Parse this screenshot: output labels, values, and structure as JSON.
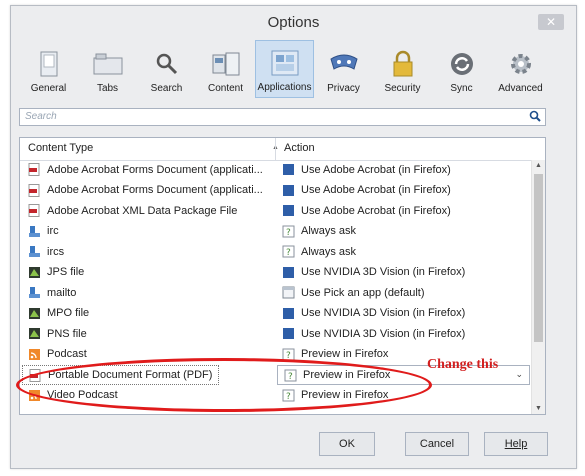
{
  "window": {
    "title": "Options",
    "close_label": "✕"
  },
  "toolbar": {
    "items": [
      {
        "label": "General",
        "icon": "general-icon"
      },
      {
        "label": "Tabs",
        "icon": "tabs-icon"
      },
      {
        "label": "Search",
        "icon": "search-icon"
      },
      {
        "label": "Content",
        "icon": "content-icon"
      },
      {
        "label": "Applications",
        "icon": "applications-icon",
        "selected": true
      },
      {
        "label": "Privacy",
        "icon": "privacy-icon"
      },
      {
        "label": "Security",
        "icon": "security-icon"
      },
      {
        "label": "Sync",
        "icon": "sync-icon"
      },
      {
        "label": "Advanced",
        "icon": "advanced-icon"
      }
    ]
  },
  "search": {
    "placeholder": "Search"
  },
  "table": {
    "headers": {
      "content_type": "Content Type",
      "action": "Action"
    },
    "rows": [
      {
        "type": "Adobe Acrobat Forms Document (applicati...",
        "action": "Use Adobe Acrobat (in Firefox)",
        "type_icon": "pdf-icon",
        "action_icon": "blue-app-icon"
      },
      {
        "type": "Adobe Acrobat Forms Document (applicati...",
        "action": "Use Adobe Acrobat (in Firefox)",
        "type_icon": "pdf-icon",
        "action_icon": "blue-app-icon"
      },
      {
        "type": "Adobe Acrobat XML Data Package File",
        "action": "Use Adobe Acrobat (in Firefox)",
        "type_icon": "pdf-icon",
        "action_icon": "blue-app-icon"
      },
      {
        "type": "irc",
        "action": "Always ask",
        "type_icon": "chat-icon",
        "action_icon": "ask-icon"
      },
      {
        "type": "ircs",
        "action": "Always ask",
        "type_icon": "chat-icon",
        "action_icon": "ask-icon"
      },
      {
        "type": "JPS file",
        "action": "Use NVIDIA 3D Vision (in Firefox)",
        "type_icon": "nvidia-icon",
        "action_icon": "blue-app-icon"
      },
      {
        "type": "mailto",
        "action": "Use Pick an app (default)",
        "type_icon": "chat-icon",
        "action_icon": "window-icon"
      },
      {
        "type": "MPO file",
        "action": "Use NVIDIA 3D Vision (in Firefox)",
        "type_icon": "nvidia-icon",
        "action_icon": "blue-app-icon"
      },
      {
        "type": "PNS file",
        "action": "Use NVIDIA 3D Vision (in Firefox)",
        "type_icon": "nvidia-icon",
        "action_icon": "blue-app-icon"
      },
      {
        "type": "Podcast",
        "action": "Preview in Firefox",
        "type_icon": "rss-icon",
        "action_icon": "ask-icon"
      },
      {
        "type": "Portable Document Format (PDF)",
        "action": "Preview in Firefox",
        "type_icon": "pdf-icon",
        "action_icon": "ask-icon",
        "selected": true
      },
      {
        "type": "Video Podcast",
        "action": "Preview in Firefox",
        "type_icon": "rss-icon",
        "action_icon": "ask-icon"
      }
    ]
  },
  "annotation": {
    "text": "Change this",
    "color": "#d21f1f"
  },
  "buttons": {
    "ok": "OK",
    "cancel": "Cancel",
    "help": "Help"
  }
}
